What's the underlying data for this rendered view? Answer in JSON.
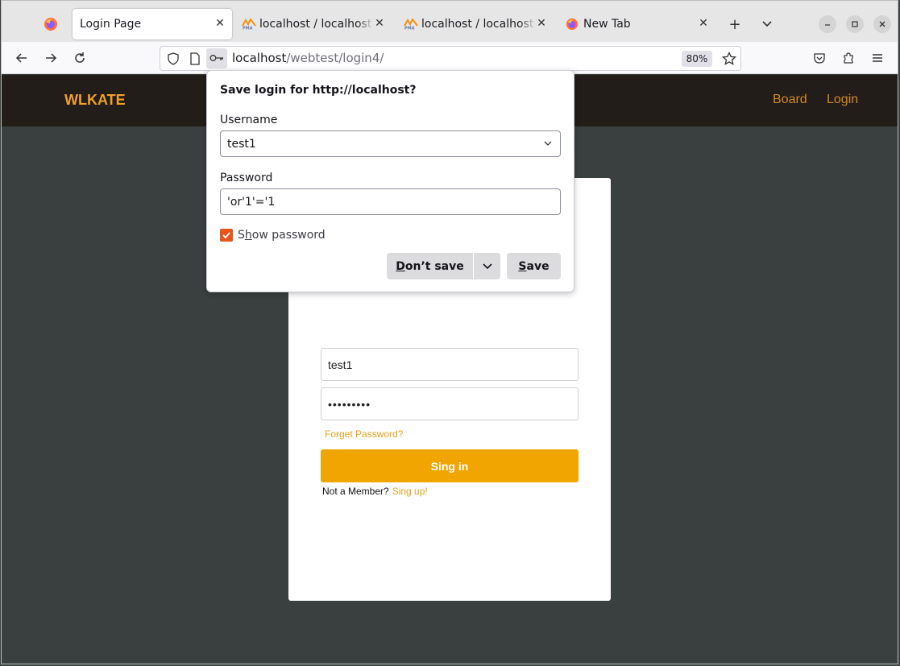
{
  "browser": {
    "tabs": [
      {
        "title": "Login Page",
        "icon": "firefox-icon",
        "active": true
      },
      {
        "title": "localhost / localhost / ",
        "icon": "phpmyadmin-icon",
        "active": false
      },
      {
        "title": "localhost / localhost / ",
        "icon": "phpmyadmin-icon",
        "active": false
      },
      {
        "title": "New Tab",
        "icon": "firefox-icon",
        "active": false
      }
    ],
    "url_host": "localhost",
    "url_path": "/webtest/login4/",
    "zoom": "80%"
  },
  "site": {
    "brand": "WLKATE",
    "nav": [
      {
        "label": "Board"
      },
      {
        "label": "Login"
      }
    ],
    "login_form": {
      "username_value": "test1",
      "password_value": "•••••••••",
      "forget_label": "Forget Password?",
      "signin_label": "Sing in",
      "member_text": "Not a Member?",
      "signup_label": "Sing up!"
    }
  },
  "save_login_popup": {
    "title": "Save login for http://localhost?",
    "username_label": "Username",
    "username_value": "test1",
    "password_label": "Password",
    "password_value": "'or'1'='1",
    "show_password_label_prefix": "S",
    "show_password_label_hotkey": "h",
    "show_password_label_rest": "ow password",
    "show_password_checked": true,
    "dont_save_hotkey": "D",
    "dont_save_rest": "on’t save",
    "save_hotkey": "S",
    "save_rest": "ave"
  },
  "colors": {
    "accent_orange": "#f0a500",
    "page_bg": "#3a3f3f",
    "header_bg": "#221d19",
    "checkbox": "#e8541e"
  }
}
